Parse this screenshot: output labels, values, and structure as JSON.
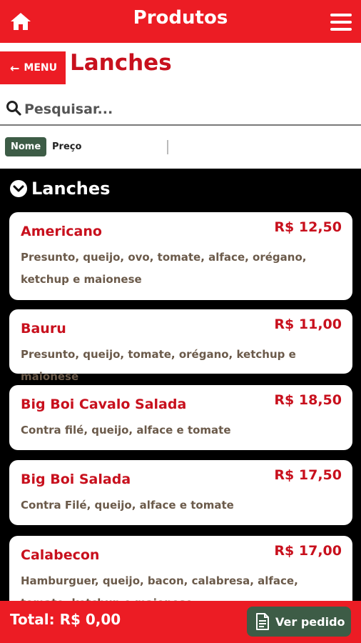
{
  "header": {
    "title": "Produtos"
  },
  "nav": {
    "menu_label": "MENU",
    "section_title": "Lanches"
  },
  "search": {
    "placeholder": "Pesquisar..."
  },
  "sort": {
    "options": [
      "Nome",
      "Preço"
    ],
    "active": "Nome"
  },
  "category": {
    "title": "Lanches"
  },
  "products": [
    {
      "name": "Americano",
      "price": "R$ 12,50",
      "description": "Presunto, queijo, ovo, tomate, alface, orégano, ketchup e maionese"
    },
    {
      "name": "Bauru",
      "price": "R$ 11,00",
      "description": "Presunto, queijo, tomate, orégano, ketchup e maionese"
    },
    {
      "name": "Big Boi Cavalo Salada",
      "price": "R$ 18,50",
      "description": "Contra filé, queijo, alface e tomate"
    },
    {
      "name": "Big Boi Salada",
      "price": "R$ 17,50",
      "description": "Contra Filé, queijo, alface e tomate"
    },
    {
      "name": "Calabecon",
      "price": "R$ 17,00",
      "description": "Hamburguer, queijo, bacon, calabresa, alface, tomate, ketchup e maionese"
    }
  ],
  "footer": {
    "total": "Total: R$ 0,00",
    "order_button": "Ver pedido"
  },
  "colors": {
    "brand_red": "#ec1c24",
    "title_red": "#c8101d",
    "accent_green": "#3d5c46"
  }
}
